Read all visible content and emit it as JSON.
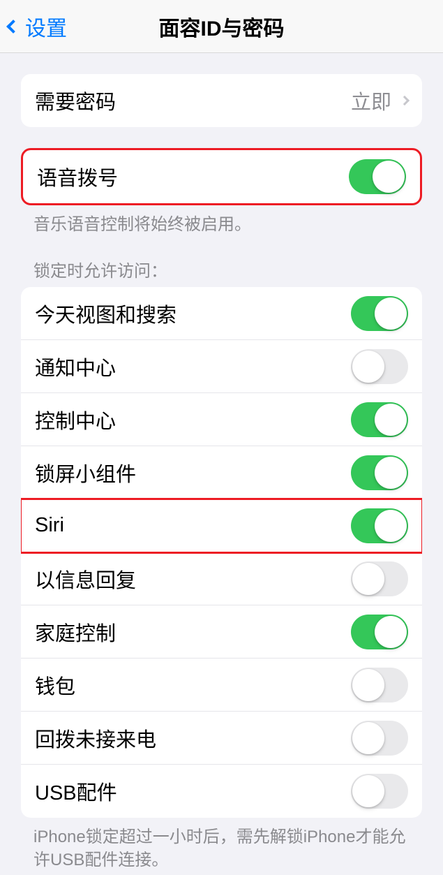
{
  "nav": {
    "back": "设置",
    "title": "面容ID与密码"
  },
  "passcode": {
    "label": "需要密码",
    "value": "立即"
  },
  "voiceDial": {
    "label": "语音拨号",
    "on": true,
    "footer": "音乐语音控制将始终被启用。"
  },
  "lockedAccess": {
    "header": "锁定时允许访问：",
    "items": [
      {
        "label": "今天视图和搜索",
        "on": true
      },
      {
        "label": "通知中心",
        "on": false
      },
      {
        "label": "控制中心",
        "on": true
      },
      {
        "label": "锁屏小组件",
        "on": true
      },
      {
        "label": "Siri",
        "on": true
      },
      {
        "label": "以信息回复",
        "on": false
      },
      {
        "label": "家庭控制",
        "on": true
      },
      {
        "label": "钱包",
        "on": false
      },
      {
        "label": "回拨未接来电",
        "on": false
      },
      {
        "label": "USB配件",
        "on": false
      }
    ],
    "footer": "iPhone锁定超过一小时后，需先解锁iPhone才能允许USB配件连接。"
  }
}
